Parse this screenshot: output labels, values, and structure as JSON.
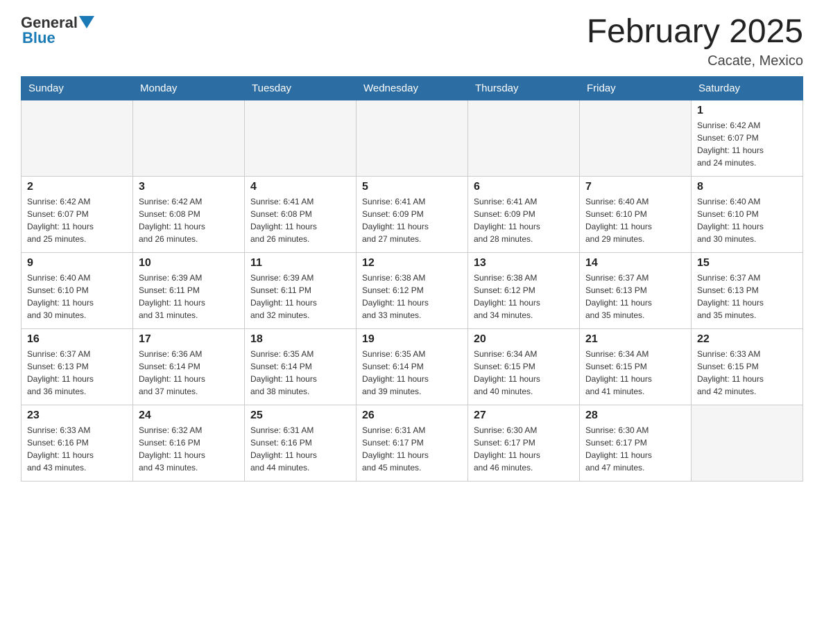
{
  "header": {
    "logo": {
      "general": "General",
      "blue": "Blue"
    },
    "title": "February 2025",
    "location": "Cacate, Mexico"
  },
  "weekdays": [
    "Sunday",
    "Monday",
    "Tuesday",
    "Wednesday",
    "Thursday",
    "Friday",
    "Saturday"
  ],
  "weeks": [
    [
      {
        "day": "",
        "info": ""
      },
      {
        "day": "",
        "info": ""
      },
      {
        "day": "",
        "info": ""
      },
      {
        "day": "",
        "info": ""
      },
      {
        "day": "",
        "info": ""
      },
      {
        "day": "",
        "info": ""
      },
      {
        "day": "1",
        "info": "Sunrise: 6:42 AM\nSunset: 6:07 PM\nDaylight: 11 hours\nand 24 minutes."
      }
    ],
    [
      {
        "day": "2",
        "info": "Sunrise: 6:42 AM\nSunset: 6:07 PM\nDaylight: 11 hours\nand 25 minutes."
      },
      {
        "day": "3",
        "info": "Sunrise: 6:42 AM\nSunset: 6:08 PM\nDaylight: 11 hours\nand 26 minutes."
      },
      {
        "day": "4",
        "info": "Sunrise: 6:41 AM\nSunset: 6:08 PM\nDaylight: 11 hours\nand 26 minutes."
      },
      {
        "day": "5",
        "info": "Sunrise: 6:41 AM\nSunset: 6:09 PM\nDaylight: 11 hours\nand 27 minutes."
      },
      {
        "day": "6",
        "info": "Sunrise: 6:41 AM\nSunset: 6:09 PM\nDaylight: 11 hours\nand 28 minutes."
      },
      {
        "day": "7",
        "info": "Sunrise: 6:40 AM\nSunset: 6:10 PM\nDaylight: 11 hours\nand 29 minutes."
      },
      {
        "day": "8",
        "info": "Sunrise: 6:40 AM\nSunset: 6:10 PM\nDaylight: 11 hours\nand 30 minutes."
      }
    ],
    [
      {
        "day": "9",
        "info": "Sunrise: 6:40 AM\nSunset: 6:10 PM\nDaylight: 11 hours\nand 30 minutes."
      },
      {
        "day": "10",
        "info": "Sunrise: 6:39 AM\nSunset: 6:11 PM\nDaylight: 11 hours\nand 31 minutes."
      },
      {
        "day": "11",
        "info": "Sunrise: 6:39 AM\nSunset: 6:11 PM\nDaylight: 11 hours\nand 32 minutes."
      },
      {
        "day": "12",
        "info": "Sunrise: 6:38 AM\nSunset: 6:12 PM\nDaylight: 11 hours\nand 33 minutes."
      },
      {
        "day": "13",
        "info": "Sunrise: 6:38 AM\nSunset: 6:12 PM\nDaylight: 11 hours\nand 34 minutes."
      },
      {
        "day": "14",
        "info": "Sunrise: 6:37 AM\nSunset: 6:13 PM\nDaylight: 11 hours\nand 35 minutes."
      },
      {
        "day": "15",
        "info": "Sunrise: 6:37 AM\nSunset: 6:13 PM\nDaylight: 11 hours\nand 35 minutes."
      }
    ],
    [
      {
        "day": "16",
        "info": "Sunrise: 6:37 AM\nSunset: 6:13 PM\nDaylight: 11 hours\nand 36 minutes."
      },
      {
        "day": "17",
        "info": "Sunrise: 6:36 AM\nSunset: 6:14 PM\nDaylight: 11 hours\nand 37 minutes."
      },
      {
        "day": "18",
        "info": "Sunrise: 6:35 AM\nSunset: 6:14 PM\nDaylight: 11 hours\nand 38 minutes."
      },
      {
        "day": "19",
        "info": "Sunrise: 6:35 AM\nSunset: 6:14 PM\nDaylight: 11 hours\nand 39 minutes."
      },
      {
        "day": "20",
        "info": "Sunrise: 6:34 AM\nSunset: 6:15 PM\nDaylight: 11 hours\nand 40 minutes."
      },
      {
        "day": "21",
        "info": "Sunrise: 6:34 AM\nSunset: 6:15 PM\nDaylight: 11 hours\nand 41 minutes."
      },
      {
        "day": "22",
        "info": "Sunrise: 6:33 AM\nSunset: 6:15 PM\nDaylight: 11 hours\nand 42 minutes."
      }
    ],
    [
      {
        "day": "23",
        "info": "Sunrise: 6:33 AM\nSunset: 6:16 PM\nDaylight: 11 hours\nand 43 minutes."
      },
      {
        "day": "24",
        "info": "Sunrise: 6:32 AM\nSunset: 6:16 PM\nDaylight: 11 hours\nand 43 minutes."
      },
      {
        "day": "25",
        "info": "Sunrise: 6:31 AM\nSunset: 6:16 PM\nDaylight: 11 hours\nand 44 minutes."
      },
      {
        "day": "26",
        "info": "Sunrise: 6:31 AM\nSunset: 6:17 PM\nDaylight: 11 hours\nand 45 minutes."
      },
      {
        "day": "27",
        "info": "Sunrise: 6:30 AM\nSunset: 6:17 PM\nDaylight: 11 hours\nand 46 minutes."
      },
      {
        "day": "28",
        "info": "Sunrise: 6:30 AM\nSunset: 6:17 PM\nDaylight: 11 hours\nand 47 minutes."
      },
      {
        "day": "",
        "info": ""
      }
    ]
  ]
}
